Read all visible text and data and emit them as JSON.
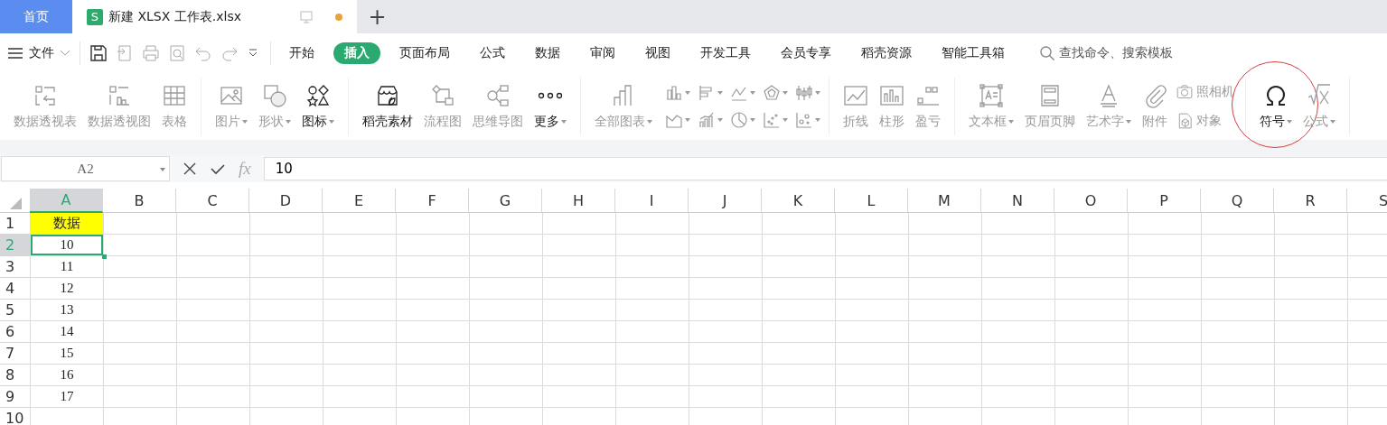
{
  "tabs": [
    {
      "label": "首页",
      "kind": "home",
      "selected": false
    },
    {
      "label": "新建 XLSX 工作表.xlsx",
      "kind": "doc",
      "selected": true,
      "app_icon": "S",
      "modified": true
    }
  ],
  "new_tab": "+",
  "file_menu": "文件",
  "ribbon_tabs": [
    {
      "label": "开始",
      "selected": false
    },
    {
      "label": "插入",
      "selected": true
    },
    {
      "label": "页面布局",
      "selected": false
    },
    {
      "label": "公式",
      "selected": false
    },
    {
      "label": "数据",
      "selected": false
    },
    {
      "label": "审阅",
      "selected": false
    },
    {
      "label": "视图",
      "selected": false
    },
    {
      "label": "开发工具",
      "selected": false
    },
    {
      "label": "会员专享",
      "selected": false
    },
    {
      "label": "稻壳资源",
      "selected": false
    },
    {
      "label": "智能工具箱",
      "selected": false
    }
  ],
  "search": {
    "placeholder": "查找命令、搜索模板"
  },
  "ribbon_groups": [
    {
      "items": [
        {
          "kind": "large",
          "label": "数据透视表",
          "disabled": true,
          "dropdown": false
        },
        {
          "kind": "large",
          "label": "数据透视图",
          "disabled": true,
          "dropdown": false
        },
        {
          "kind": "large",
          "label": "表格",
          "disabled": true,
          "dropdown": false
        }
      ]
    },
    {
      "items": [
        {
          "kind": "large",
          "label": "图片",
          "disabled": true,
          "dropdown": true
        },
        {
          "kind": "large",
          "label": "形状",
          "disabled": true,
          "dropdown": true
        },
        {
          "kind": "large",
          "label": "图标",
          "disabled": false,
          "dropdown": true
        }
      ]
    },
    {
      "items": [
        {
          "kind": "large",
          "label": "稻壳素材",
          "disabled": false,
          "dropdown": false
        },
        {
          "kind": "large",
          "label": "流程图",
          "disabled": true,
          "dropdown": false
        },
        {
          "kind": "large",
          "label": "思维导图",
          "disabled": true,
          "dropdown": false
        },
        {
          "kind": "large",
          "label": "更多",
          "disabled": false,
          "dropdown": true
        }
      ]
    },
    {
      "items": [
        {
          "kind": "large",
          "label": "全部图表",
          "disabled": true,
          "dropdown": true
        },
        {
          "kind": "chart-gallery"
        }
      ]
    },
    {
      "items": [
        {
          "kind": "large",
          "label": "折线",
          "disabled": true,
          "dropdown": false
        },
        {
          "kind": "large",
          "label": "柱形",
          "disabled": true,
          "dropdown": false
        },
        {
          "kind": "large",
          "label": "盈亏",
          "disabled": true,
          "dropdown": false
        }
      ]
    },
    {
      "items": [
        {
          "kind": "large",
          "label": "文本框",
          "disabled": true,
          "dropdown": true
        },
        {
          "kind": "large",
          "label": "页眉页脚",
          "disabled": true,
          "dropdown": false
        },
        {
          "kind": "large",
          "label": "艺术字",
          "disabled": true,
          "dropdown": true
        },
        {
          "kind": "large",
          "label": "附件",
          "disabled": true,
          "dropdown": false
        },
        {
          "kind": "small",
          "label": "照相机",
          "disabled": true
        },
        {
          "kind": "small",
          "label": "对象",
          "disabled": true
        }
      ]
    },
    {
      "items": [
        {
          "kind": "large",
          "label": "符号",
          "disabled": false,
          "dropdown": true,
          "circled": true
        },
        {
          "kind": "large",
          "label": "公式",
          "disabled": true,
          "dropdown": true,
          "circled": false
        }
      ]
    }
  ],
  "formula_bar": {
    "name_box": "A2",
    "fx": "fx",
    "value": "10"
  },
  "sheet": {
    "columns": [
      {
        "label": "A",
        "selected": true
      },
      {
        "label": "B",
        "selected": false
      },
      {
        "label": "C",
        "selected": false
      },
      {
        "label": "D",
        "selected": false
      },
      {
        "label": "E",
        "selected": false
      },
      {
        "label": "F",
        "selected": false
      },
      {
        "label": "G",
        "selected": false
      },
      {
        "label": "H",
        "selected": false
      },
      {
        "label": "I",
        "selected": false
      },
      {
        "label": "J",
        "selected": false
      },
      {
        "label": "K",
        "selected": false
      },
      {
        "label": "L",
        "selected": false
      },
      {
        "label": "M",
        "selected": false
      },
      {
        "label": "N",
        "selected": false
      },
      {
        "label": "O",
        "selected": false
      },
      {
        "label": "P",
        "selected": false
      },
      {
        "label": "Q",
        "selected": false
      },
      {
        "label": "R",
        "selected": false
      },
      {
        "label": "S",
        "selected": false
      }
    ],
    "rows": [
      {
        "label": "1",
        "selected": false,
        "cells": [
          {
            "text": "数据",
            "highlighted": true,
            "selected": false
          }
        ]
      },
      {
        "label": "2",
        "selected": true,
        "cells": [
          {
            "text": "10",
            "highlighted": false,
            "selected": true
          }
        ]
      },
      {
        "label": "3",
        "selected": false,
        "cells": [
          {
            "text": "11",
            "highlighted": false,
            "selected": false
          }
        ]
      },
      {
        "label": "4",
        "selected": false,
        "cells": [
          {
            "text": "12",
            "highlighted": false,
            "selected": false
          }
        ]
      },
      {
        "label": "5",
        "selected": false,
        "cells": [
          {
            "text": "13",
            "highlighted": false,
            "selected": false
          }
        ]
      },
      {
        "label": "6",
        "selected": false,
        "cells": [
          {
            "text": "14",
            "highlighted": false,
            "selected": false
          }
        ]
      },
      {
        "label": "7",
        "selected": false,
        "cells": [
          {
            "text": "15",
            "highlighted": false,
            "selected": false
          }
        ]
      },
      {
        "label": "8",
        "selected": false,
        "cells": [
          {
            "text": "16",
            "highlighted": false,
            "selected": false
          }
        ]
      },
      {
        "label": "9",
        "selected": false,
        "cells": [
          {
            "text": "17",
            "highlighted": false,
            "selected": false
          }
        ]
      },
      {
        "label": "10",
        "selected": false,
        "cells": []
      }
    ]
  }
}
